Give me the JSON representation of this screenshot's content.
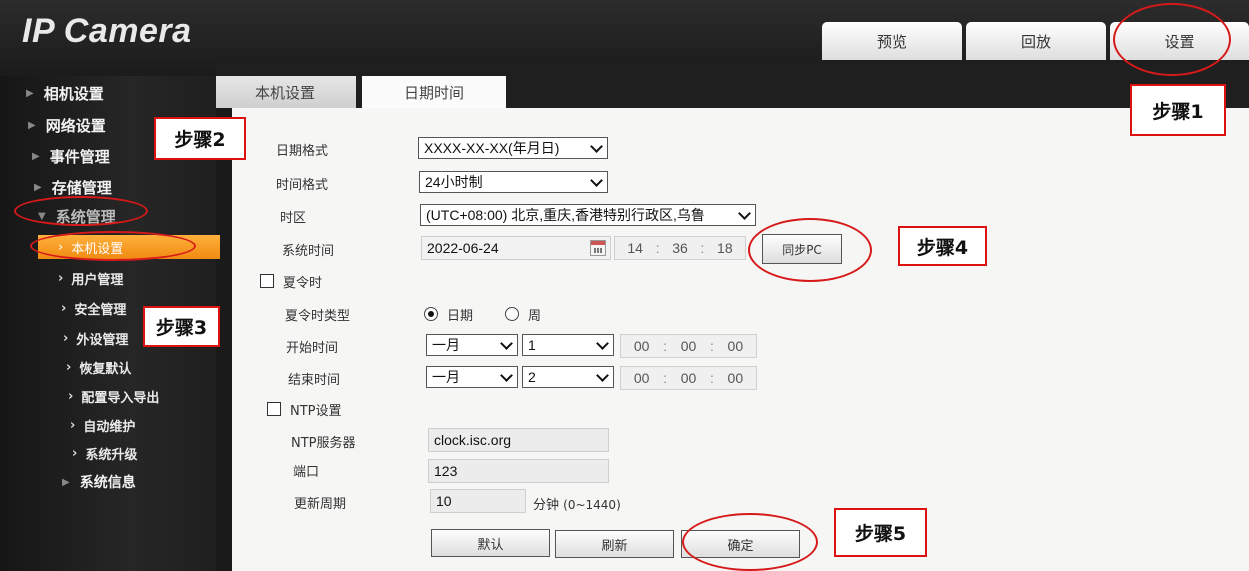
{
  "app": {
    "title": "IP Camera"
  },
  "top_nav": {
    "preview": "预览",
    "playback": "回放",
    "settings": "设置"
  },
  "sidebar": {
    "camera": "相机设置",
    "network": "网络设置",
    "event": "事件管理",
    "storage": "存储管理",
    "system": "系统管理",
    "items": [
      "本机设置",
      "用户管理",
      "安全管理",
      "外设管理",
      "恢复默认",
      "配置导入导出",
      "自动维护",
      "系统升级"
    ],
    "sysinfo": "系统信息"
  },
  "tabs": {
    "local": "本机设置",
    "datetime": "日期时间"
  },
  "form": {
    "date_format_label": "日期格式",
    "date_format_value": "XXXX-XX-XX(年月日)",
    "time_format_label": "时间格式",
    "time_format_value": "24小时制",
    "timezone_label": "时区",
    "timezone_value": "(UTC+08:00) 北京,重庆,香港特别行政区,乌鲁",
    "systime_label": "系统时间",
    "systime_date": "2022-06-24",
    "systime_h": "14",
    "systime_m": "36",
    "systime_s": "18",
    "sync_pc": "同步PC",
    "dst_label": "夏令时",
    "dst_type_label": "夏令时类型",
    "dst_type_date": "日期",
    "dst_type_week": "周",
    "start_label": "开始时间",
    "start_month": "一月",
    "start_day": "1",
    "end_label": "结束时间",
    "end_month": "一月",
    "end_day": "2",
    "zero": "00",
    "ntp_label": "NTP设置",
    "ntp_server_label": "NTP服务器",
    "ntp_server_value": "clock.isc.org",
    "port_label": "端口",
    "port_value": "123",
    "period_label": "更新周期",
    "period_value": "10",
    "period_unit": "分钟",
    "period_range": "(0~1440)"
  },
  "buttons": {
    "default": "默认",
    "refresh": "刷新",
    "ok": "确定"
  },
  "steps": {
    "s1": "步骤1",
    "s2": "步骤2",
    "s3": "步骤3",
    "s4": "步骤4",
    "s5": "步骤5"
  },
  "colors": {
    "accent": "#f59a1e",
    "annotation": "#d61a1a"
  }
}
